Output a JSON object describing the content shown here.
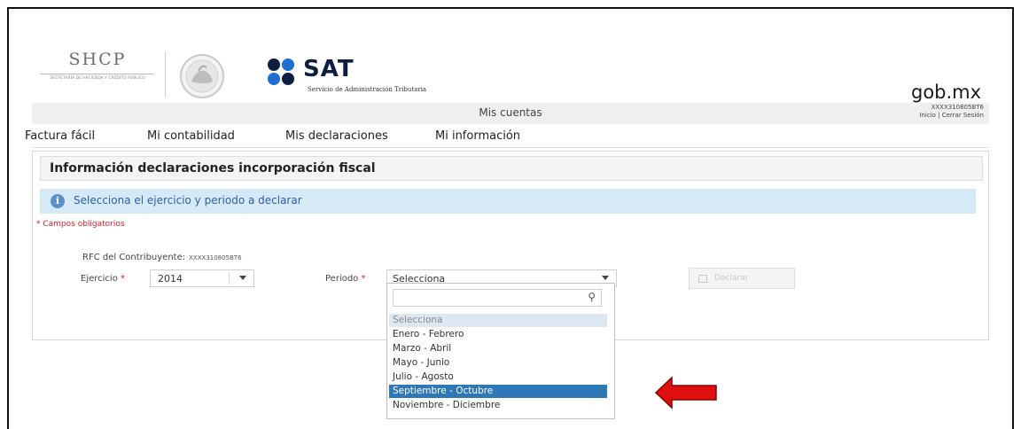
{
  "header": {
    "shcp_title": "SHCP",
    "shcp_subtitle": "SECRETARÍA DE HACIENDA Y CRÉDITO PÚBLICO",
    "sat_word": "SAT",
    "sat_subtitle": "Servicio de Administración Tributaria",
    "gob_logo": "gob.mx",
    "colors": {
      "sat_navy": "#0c1f43",
      "sat_blue": "#1e6fd0"
    }
  },
  "topbar": {
    "title": "Mis cuentas",
    "rfc": "XXXX310805BT6",
    "links": "Inicio | Cerrar Sesión"
  },
  "nav": {
    "items": [
      {
        "label": "Factura fácil"
      },
      {
        "label": "Mi contabilidad"
      },
      {
        "label": "Mis declaraciones"
      },
      {
        "label": "Mi información"
      }
    ]
  },
  "panel": {
    "title": "Información declaraciones incorporación fiscal",
    "info_icon": "info-icon",
    "info_message": "Selecciona el ejercicio y periodo a declarar",
    "required_note": "* Campos obligatorios",
    "rfc_label": "RFC del Contribuyente:",
    "rfc_value": "XXXX310805BT6",
    "ejercicio_label": "Ejercicio",
    "ejercicio_value": "2014",
    "periodo_label": "Periodo",
    "periodo_value": "Selecciona",
    "declarar_label": "Declarar",
    "asterisk": "*"
  },
  "dropdown": {
    "search_value": "",
    "search_icon": "search-icon",
    "options": [
      {
        "label": "Selecciona",
        "state": "placeholder"
      },
      {
        "label": "Enero - Febrero",
        "state": "normal"
      },
      {
        "label": "Marzo - Abril",
        "state": "normal"
      },
      {
        "label": "Mayo - Junio",
        "state": "normal"
      },
      {
        "label": "Julio - Agosto",
        "state": "normal"
      },
      {
        "label": "Septiembre - Octubre",
        "state": "highlighted"
      },
      {
        "label": "Noviembre - Diciembre",
        "state": "normal"
      }
    ],
    "highlight_color": "#2f78b8"
  },
  "annotation": {
    "arrow_color": "#e01010",
    "arrow_icon": "arrow-left-icon"
  }
}
